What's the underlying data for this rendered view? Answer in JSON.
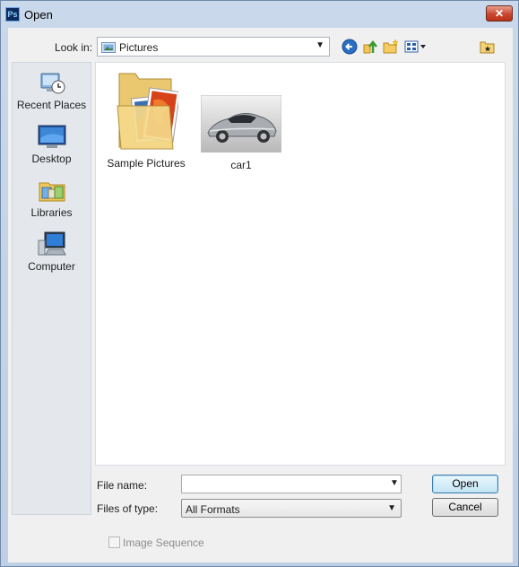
{
  "window": {
    "title": "Open",
    "app_icon_text": "Ps",
    "close_glyph": "✕"
  },
  "toolbar": {
    "look_in_label": "Look in:",
    "look_in_value": "Pictures",
    "tools": [
      "back-icon",
      "up-folder-icon",
      "new-folder-icon",
      "view-menu-icon",
      "favorite-folder-icon"
    ]
  },
  "places": [
    {
      "label": "Recent Places",
      "icon": "recent-places-icon"
    },
    {
      "label": "Desktop",
      "icon": "desktop-icon"
    },
    {
      "label": "Libraries",
      "icon": "libraries-icon"
    },
    {
      "label": "Computer",
      "icon": "computer-icon"
    }
  ],
  "files": [
    {
      "name": "Sample Pictures",
      "type": "folder"
    },
    {
      "name": "car1",
      "type": "image"
    }
  ],
  "form": {
    "file_name_label": "File name:",
    "file_name_value": "",
    "file_type_label": "Files of type:",
    "file_type_value": "All Formats",
    "open_button": "Open",
    "cancel_button": "Cancel",
    "image_sequence_label": "Image Sequence",
    "image_sequence_checked": false,
    "image_sequence_enabled": false
  },
  "colors": {
    "accent": "#3c7fb1",
    "close": "#c9462e"
  }
}
